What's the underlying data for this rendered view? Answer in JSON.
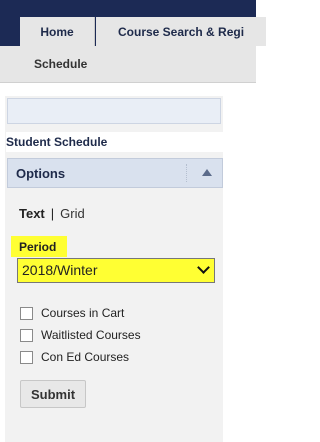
{
  "nav": {
    "tabs": [
      {
        "label": "Home"
      },
      {
        "label": "Course Search & Regi"
      }
    ],
    "subnav": {
      "label": "Schedule"
    }
  },
  "sidebar": {
    "section_title": "Student Schedule",
    "options": {
      "title": "Options",
      "view_toggle": {
        "text": "Text",
        "separator": "|",
        "grid": "Grid"
      },
      "period": {
        "label": "Period",
        "value": "2018/Winter"
      },
      "checkboxes": [
        {
          "label": "Courses in Cart",
          "checked": false
        },
        {
          "label": "Waitlisted Courses",
          "checked": false
        },
        {
          "label": "Con Ed Courses",
          "checked": false
        }
      ],
      "submit_label": "Submit"
    }
  },
  "colors": {
    "nav_bar": "#1c2a55",
    "highlight": "#ffff33",
    "options_header": "#d9e1ee"
  },
  "icons": {
    "collapse": "triangle-up-icon",
    "dropdown": "chevron-down-icon"
  }
}
